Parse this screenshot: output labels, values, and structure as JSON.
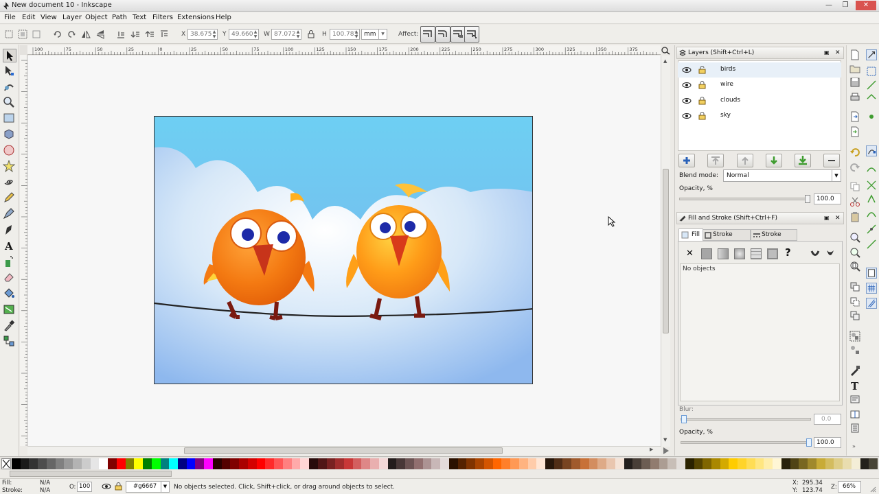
{
  "window": {
    "title": "New document 10 - Inkscape",
    "minimize": "—",
    "restore": "❐",
    "close": "✕"
  },
  "menu": [
    "File",
    "Edit",
    "View",
    "Layer",
    "Object",
    "Path",
    "Text",
    "Filters",
    "Extensions",
    "Help"
  ],
  "controls": {
    "x_label": "X",
    "x_value": "38.675",
    "y_label": "Y",
    "y_value": "49.660",
    "w_label": "W",
    "w_value": "87.072",
    "h_label": "H",
    "h_value": "100.783",
    "unit": "mm",
    "affect_label": "Affect:"
  },
  "ruler_labels": [
    "100",
    "75",
    "50",
    "25",
    "0",
    "25",
    "50",
    "75",
    "100",
    "125",
    "150",
    "175",
    "200",
    "225",
    "250",
    "275",
    "300",
    "325",
    "350",
    "375"
  ],
  "layers_panel": {
    "title": "Layers (Shift+Ctrl+L)",
    "layers": [
      {
        "name": "birds"
      },
      {
        "name": "wire"
      },
      {
        "name": "clouds"
      },
      {
        "name": "sky"
      }
    ],
    "blend_label": "Blend mode:",
    "blend_value": "Normal",
    "opacity_label": "Opacity, %",
    "opacity_value": "100.0",
    "opacity_fraction": 1.0
  },
  "fill_stroke_panel": {
    "title": "Fill and Stroke (Shift+Ctrl+F)",
    "tabs": [
      "Fill",
      "Stroke paint",
      "Stroke style"
    ],
    "unset_symbol": "?",
    "no_objects": "No objects",
    "blur_label": "Blur:",
    "blur_value": "0.0",
    "blur_fraction": 0.0,
    "opacity_label": "Opacity, %",
    "opacity_value": "100.0",
    "opacity_fraction": 1.0
  },
  "status": {
    "fill_label": "Fill:",
    "fill_value": "N/A",
    "stroke_label": "Stroke:",
    "stroke_value": "N/A",
    "o_label": "O:",
    "o_value": "100",
    "layer_value": "#g6667",
    "message": "No objects selected. Click, Shift+click, or drag around objects to select.",
    "x_label": "X:",
    "x_value": "295.34",
    "y_label": "Y:",
    "y_value": "123.74",
    "z_label": "Z:",
    "zoom": "66%"
  },
  "palette_colors": [
    "#000000",
    "#1a1a1a",
    "#333333",
    "#4d4d4d",
    "#666666",
    "#808080",
    "#999999",
    "#b3b3b3",
    "#cccccc",
    "#e6e6e6",
    "#ffffff",
    "#800000",
    "#ff0000",
    "#808000",
    "#ffff00",
    "#008000",
    "#00ff00",
    "#008080",
    "#00ffff",
    "#000080",
    "#0000ff",
    "#800080",
    "#ff00ff",
    "#2b0000",
    "#550000",
    "#800000",
    "#aa0000",
    "#d40000",
    "#ff0000",
    "#ff2a2a",
    "#ff5555",
    "#ff8080",
    "#ffaaaa",
    "#ffd5d5",
    "#280b0b",
    "#501616",
    "#782121",
    "#a02c2c",
    "#c83737",
    "#d35f5f",
    "#de8787",
    "#e9afaf",
    "#f4d7d7",
    "#241c1c",
    "#483737",
    "#6c5353",
    "#916f6f",
    "#ac9393",
    "#c8b7b7",
    "#e3dbdb",
    "#2b1100",
    "#552200",
    "#803300",
    "#aa4400",
    "#d45500",
    "#ff6600",
    "#ff7f2a",
    "#ff9955",
    "#ffb380",
    "#ffccaa",
    "#ffe6d5",
    "#28170b",
    "#502d16",
    "#784421",
    "#a05a2c",
    "#c87137",
    "#d38d5f",
    "#deaa87",
    "#e9c6af",
    "#f4e3d7",
    "#241f1c",
    "#483e37",
    "#6c5d53",
    "#917c6f",
    "#ac9d93",
    "#c8beb7",
    "#e3dedb",
    "#2b2200",
    "#554400",
    "#806600",
    "#aa8800",
    "#d4aa00",
    "#ffcc00",
    "#ffd42a",
    "#ffdd55",
    "#ffe680",
    "#ffeeaa",
    "#fff6d5",
    "#28220b",
    "#504416",
    "#786721",
    "#a0892c",
    "#c8ab37",
    "#d3bc5f",
    "#decd87",
    "#e9ddaf",
    "#f4eed7",
    "#24221c",
    "#484537"
  ],
  "colors": {
    "sky_top": "#6ecff3",
    "sky_bottom": "#8fc3ee",
    "bird_orange": "#f47a12",
    "bird_yellow": "#ffb020"
  }
}
